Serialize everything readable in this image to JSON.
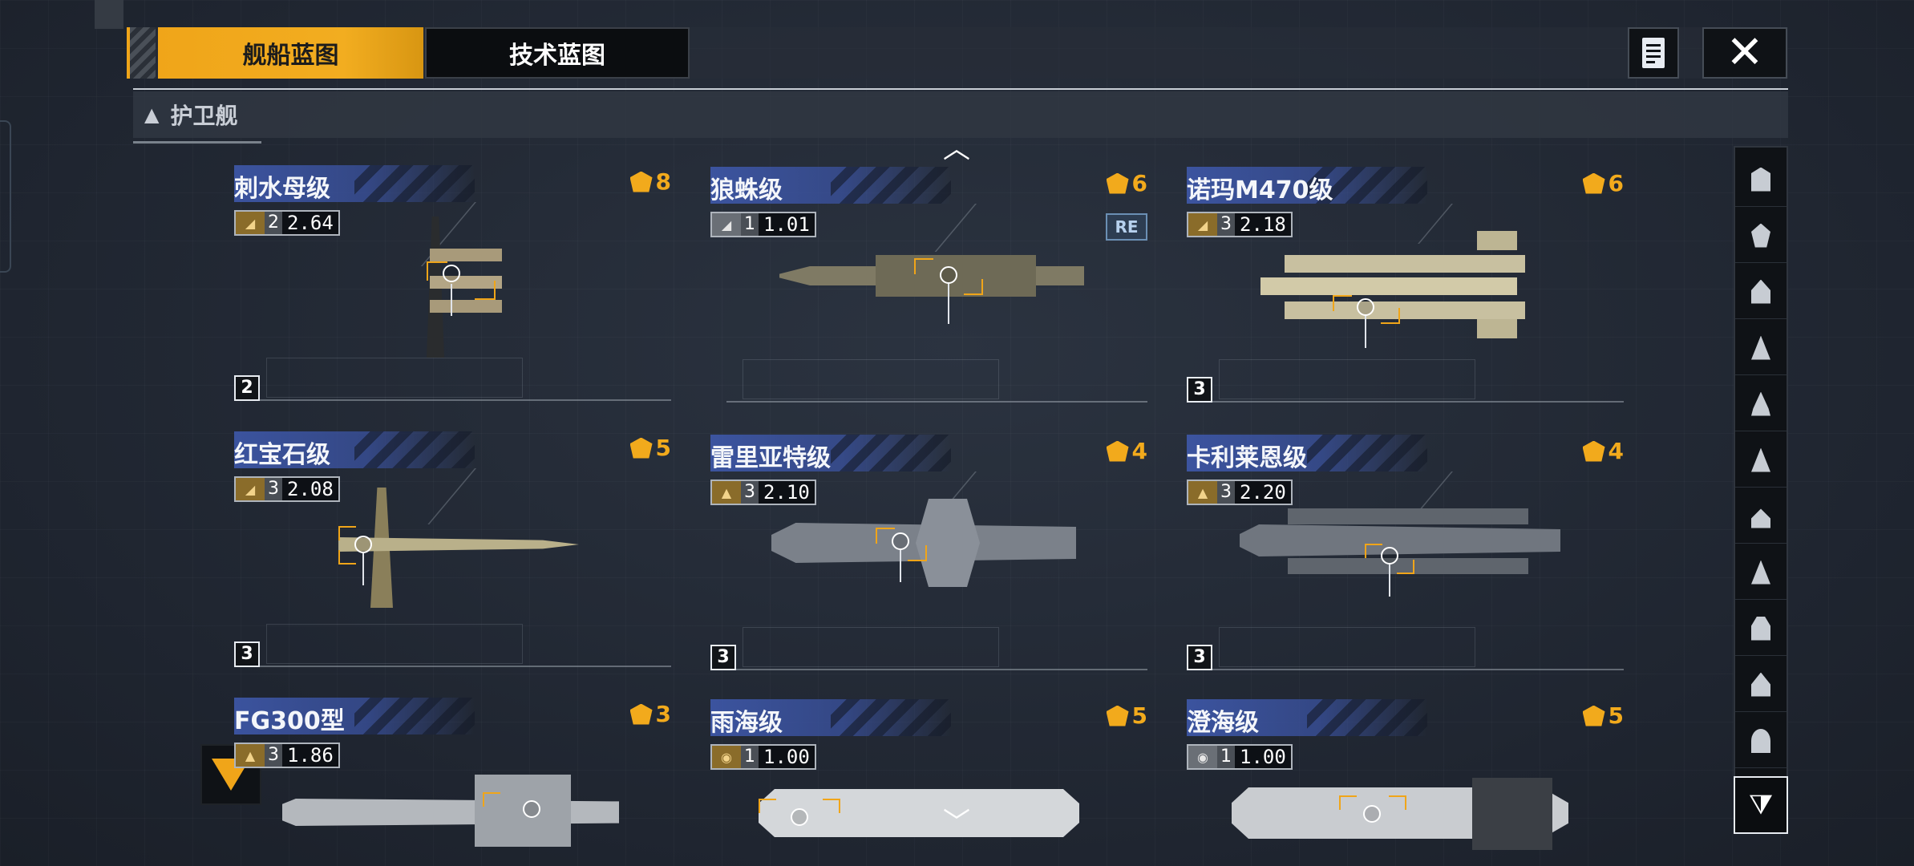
{
  "tabs": {
    "ship_blueprint": "舰船蓝图",
    "tech_blueprint": "技术蓝图"
  },
  "category": {
    "label": "护卫舰"
  },
  "icons": {
    "document": "document-icon",
    "close": "close-icon",
    "scroll_up": "chevron-up-icon",
    "scroll_down": "chevron-down-icon",
    "filter": "filter-icon"
  },
  "colors": {
    "accent": "#f0a519",
    "name_band": "#3e58aa",
    "background": "#232a34"
  },
  "ships": [
    {
      "name": "刺水母级",
      "medal": "8",
      "tier": "2",
      "value": "2.64",
      "tier_box": "2",
      "re": ""
    },
    {
      "name": "狼蛛级",
      "medal": "6",
      "tier": "1",
      "value": "1.01",
      "tier_box": "",
      "re": "RE"
    },
    {
      "name": "诺玛M470级",
      "medal": "6",
      "tier": "3",
      "value": "2.18",
      "tier_box": "3",
      "re": ""
    },
    {
      "name": "红宝石级",
      "medal": "5",
      "tier": "3",
      "value": "2.08",
      "tier_box": "3",
      "re": ""
    },
    {
      "name": "雷里亚特级",
      "medal": "4",
      "tier": "3",
      "value": "2.10",
      "tier_box": "3",
      "re": ""
    },
    {
      "name": "卡利莱恩级",
      "medal": "4",
      "tier": "3",
      "value": "2.20",
      "tier_box": "3",
      "re": ""
    },
    {
      "name": "FG300型",
      "medal": "3",
      "tier": "3",
      "value": "1.86",
      "tier_box": "",
      "re": ""
    },
    {
      "name": "雨海级",
      "medal": "5",
      "tier": "1",
      "value": "1.00",
      "tier_box": "",
      "re": ""
    },
    {
      "name": "澄海级",
      "medal": "5",
      "tier": "1",
      "value": "1.00",
      "tier_box": "",
      "re": ""
    }
  ]
}
